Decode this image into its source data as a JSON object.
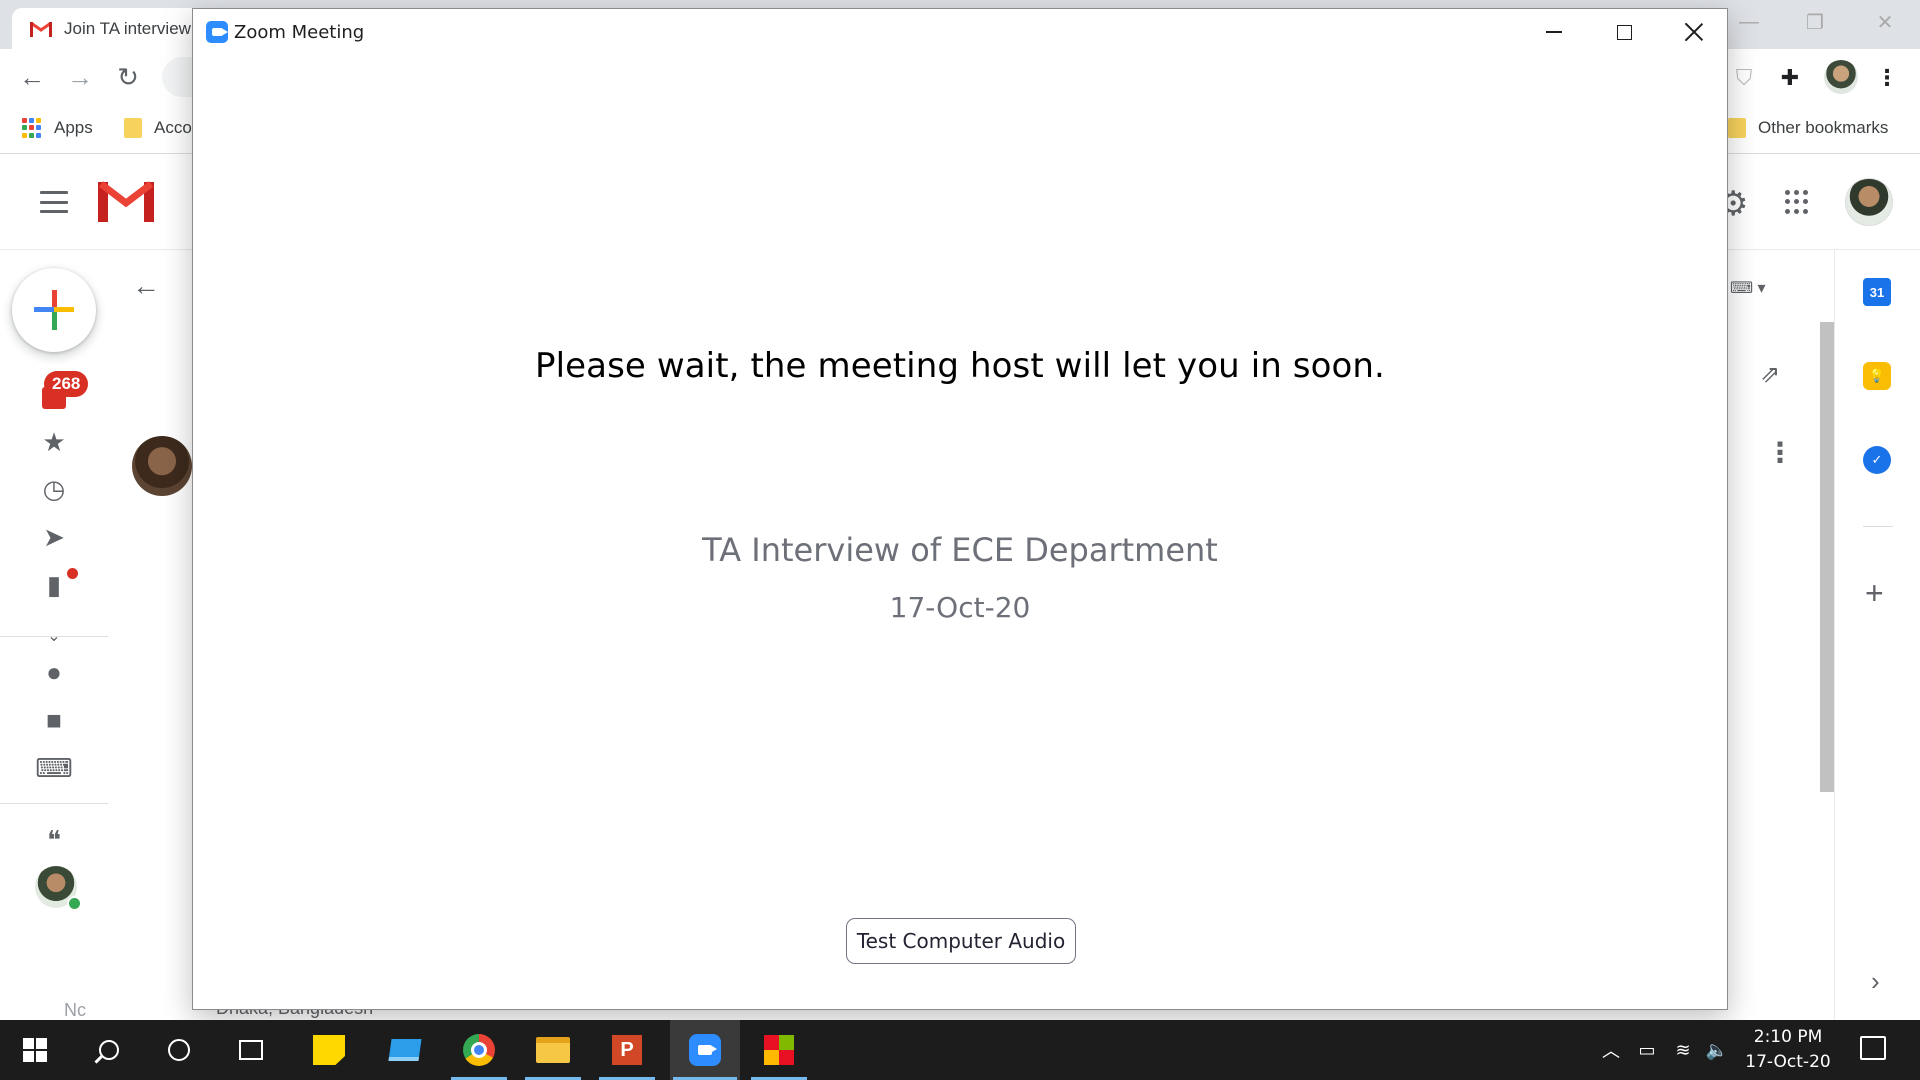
{
  "browser": {
    "tab_title": "Join TA interview",
    "bookmarks": {
      "apps": "Apps",
      "acc": "Acco",
      "other": "Other bookmarks"
    }
  },
  "gmail": {
    "inbox_count": "268",
    "partial_left_text": "Nc",
    "location_text": "Dhaka, Bangladesh",
    "calendar_label": "31"
  },
  "zoom": {
    "window_title": "Zoom Meeting",
    "wait_message": "Please wait, the meeting host will let you in soon.",
    "meeting_title": "TA Interview of ECE Department",
    "meeting_date": "17-Oct-20",
    "test_audio_label": "Test Computer Audio"
  },
  "taskbar": {
    "time": "2:10 PM",
    "date": "17-Oct-20"
  },
  "colors": {
    "zoom_blue": "#2d8cff",
    "gmail_red": "#d93025",
    "taskbar": "#1c1c1c"
  }
}
